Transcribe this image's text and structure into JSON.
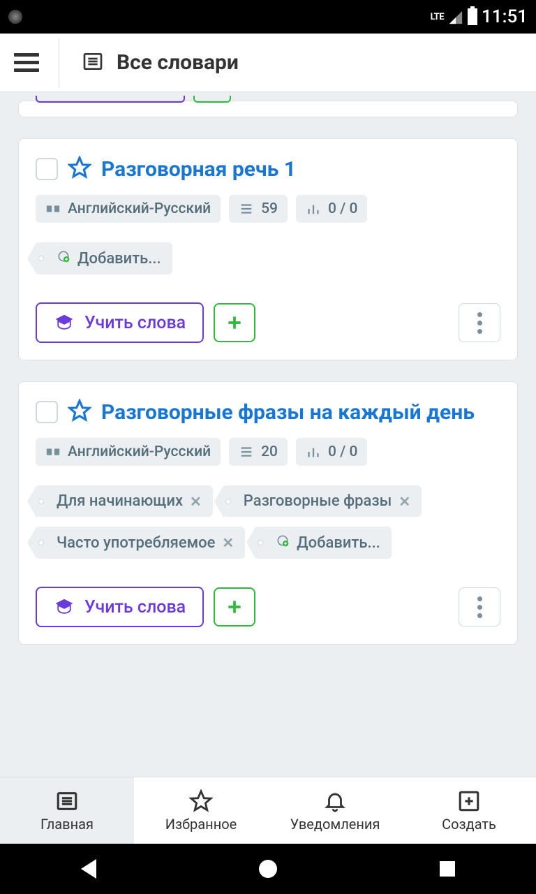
{
  "status": {
    "time": "11:51",
    "network": "LTE"
  },
  "header": {
    "title": "Все словари"
  },
  "cards": [
    {
      "title": "Разговорная речь 1",
      "language": "Английский-Русский",
      "word_count": "59",
      "progress": "0 / 0",
      "tags": [],
      "add_tag_label": "Добавить...",
      "learn_label": "Учить слова"
    },
    {
      "title": "Разговорные фразы на каждый день",
      "language": "Английский-Русский",
      "word_count": "20",
      "progress": "0 / 0",
      "tags": [
        "Для начинающих",
        "Разговорные фразы",
        "Часто употребляемое"
      ],
      "add_tag_label": "Добавить...",
      "learn_label": "Учить слова"
    }
  ],
  "nav": {
    "home": "Главная",
    "favorites": "Избранное",
    "notifications": "Уведомления",
    "create": "Создать"
  }
}
